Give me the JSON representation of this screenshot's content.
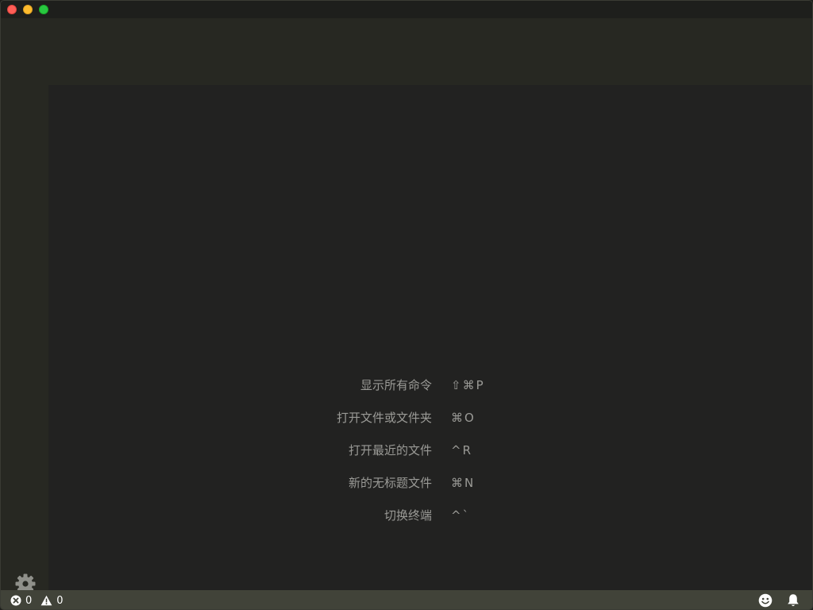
{
  "window": {
    "buttons": {
      "close": "close",
      "minimize": "minimize",
      "maximize": "maximize"
    }
  },
  "watermark": {
    "entries": [
      {
        "label": "显示所有命令",
        "keys": "⇧⌘P"
      },
      {
        "label": "打开文件或文件夹",
        "keys": "⌘O"
      },
      {
        "label": "打开最近的文件",
        "keys": "^R"
      },
      {
        "label": "新的无标题文件",
        "keys": "⌘N"
      },
      {
        "label": "切换终端",
        "keys": "^`"
      }
    ]
  },
  "activity_bar": {
    "manage_icon": "gear-icon"
  },
  "status_bar": {
    "errors": "0",
    "warnings": "0",
    "error_icon": "error-circle-icon",
    "warning_icon": "warning-triangle-icon",
    "feedback_icon": "smiley-icon",
    "notifications_icon": "bell-icon"
  },
  "colors": {
    "editor_background": "#222221",
    "sidebar_background": "#272822",
    "status_bar": "#414339",
    "watermark_text": "#9a9a96"
  }
}
